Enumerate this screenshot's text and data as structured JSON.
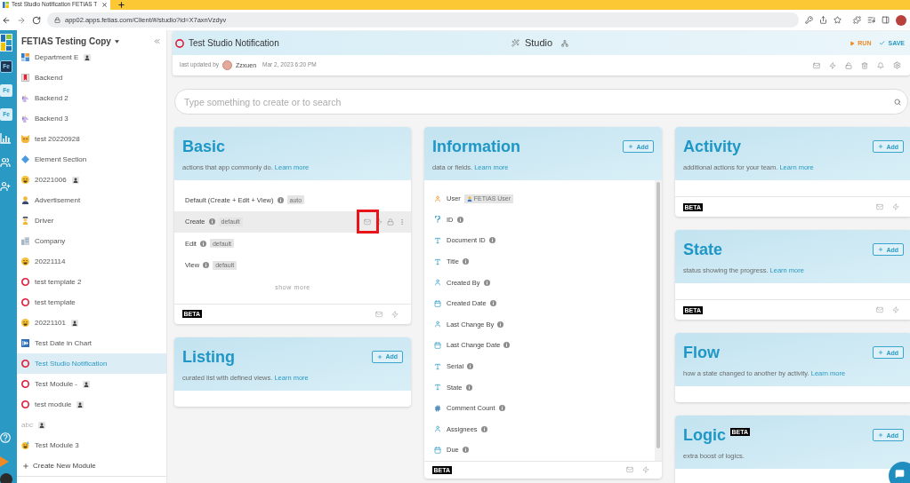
{
  "browser": {
    "tab_title": "Test Studio Notification FETIAS T",
    "url": "app02.apps.fetias.com/Client/#/studio?id=X7axnVzdyv"
  },
  "rail": {
    "tiles": [
      {
        "label": "Fe",
        "selected": true
      },
      {
        "label": "Fe",
        "selected": false
      },
      {
        "label": "Fe",
        "selected": false
      }
    ]
  },
  "sidebar": {
    "workspace": "FETIAS Testing Copy",
    "items": [
      {
        "label": "Department E",
        "badge": true,
        "selected": false,
        "disabled": false
      },
      {
        "label": "Backend",
        "badge": false,
        "selected": false,
        "disabled": false
      },
      {
        "label": "Backend 2",
        "badge": false,
        "selected": false,
        "disabled": false
      },
      {
        "label": "Backend 3",
        "badge": false,
        "selected": false,
        "disabled": false
      },
      {
        "label": "test 20220928",
        "badge": false,
        "selected": false,
        "disabled": false
      },
      {
        "label": "Element Section",
        "badge": false,
        "selected": false,
        "disabled": false
      },
      {
        "label": "20221006",
        "badge": true,
        "selected": false,
        "disabled": false
      },
      {
        "label": "Advertisement",
        "badge": false,
        "selected": false,
        "disabled": false
      },
      {
        "label": "Driver",
        "badge": false,
        "selected": false,
        "disabled": false
      },
      {
        "label": "Company",
        "badge": false,
        "selected": false,
        "disabled": false
      },
      {
        "label": "20221114",
        "badge": false,
        "selected": false,
        "disabled": false
      },
      {
        "label": "test template 2",
        "badge": false,
        "selected": false,
        "disabled": false
      },
      {
        "label": "test template",
        "badge": false,
        "selected": false,
        "disabled": false
      },
      {
        "label": "20221101",
        "badge": true,
        "selected": false,
        "disabled": false
      },
      {
        "label": "Test Date in Chart",
        "badge": false,
        "selected": false,
        "disabled": false
      },
      {
        "label": "Test Studio Notification",
        "badge": false,
        "selected": true,
        "disabled": false
      },
      {
        "label": "Test Module -",
        "badge": true,
        "selected": false,
        "disabled": false
      },
      {
        "label": "test module",
        "badge": true,
        "selected": false,
        "disabled": false
      },
      {
        "label": "abc",
        "badge": true,
        "selected": false,
        "disabled": true
      },
      {
        "label": "Test Module 3",
        "badge": false,
        "selected": false,
        "disabled": false
      }
    ],
    "create_label": "Create New Module"
  },
  "header": {
    "title": "Test Studio Notification",
    "mode": "Studio",
    "run_label": "RUN",
    "save_label": "SAVE",
    "updated_label": "last updated by",
    "updated_user": "Zzxuen",
    "updated_date": "Mar 2, 2023 6:20 PM"
  },
  "search": {
    "placeholder": "Type something to create or to search"
  },
  "board": {
    "columns": [
      {
        "cards": [
          {
            "kind": "actions",
            "title": "Basic",
            "description": "actions that app commonly do.",
            "link": "Learn more",
            "rows": [
              {
                "label": "Default (Create + Edit + View)",
                "info": true,
                "tag": "auto",
                "selected": false,
                "annotated": false
              },
              {
                "label": "Create",
                "info": true,
                "tag": "default",
                "selected": true,
                "annotated": true
              },
              {
                "label": "Edit",
                "info": true,
                "tag": "default",
                "selected": false,
                "annotated": false
              },
              {
                "label": "View",
                "info": true,
                "tag": "default",
                "selected": false,
                "annotated": false
              }
            ],
            "show_more": "show more",
            "footer_badge": "BETA"
          },
          {
            "kind": "empty",
            "title": "Listing",
            "add_label": "Add",
            "description": "curated list with defined views.",
            "link": "Learn more"
          }
        ]
      },
      {
        "cards": [
          {
            "kind": "fields",
            "title": "Information",
            "add_label": "Add",
            "description": "data or fields.",
            "link": "Learn more",
            "rows": [
              {
                "kind": "user",
                "label": "User",
                "info": false,
                "tag": "FETIAS User"
              },
              {
                "kind": "id",
                "label": "ID",
                "info": true
              },
              {
                "kind": "text",
                "label": "Document ID",
                "info": true
              },
              {
                "kind": "text",
                "label": "Title",
                "info": true
              },
              {
                "kind": "person",
                "label": "Created By",
                "info": true
              },
              {
                "kind": "date",
                "label": "Created Date",
                "info": true
              },
              {
                "kind": "person",
                "label": "Last Change By",
                "info": true
              },
              {
                "kind": "date",
                "label": "Last Change Date",
                "info": true
              },
              {
                "kind": "text",
                "label": "Serial",
                "info": true
              },
              {
                "kind": "text",
                "label": "State",
                "info": true
              },
              {
                "kind": "number",
                "label": "Comment Count",
                "info": true
              },
              {
                "kind": "person",
                "label": "Assignees",
                "info": true
              },
              {
                "kind": "date",
                "label": "Due",
                "info": true
              }
            ],
            "footer_badge": "BETA"
          }
        ]
      },
      {
        "cards": [
          {
            "kind": "empty",
            "title": "Activity",
            "add_label": "Add",
            "description": "additional actions for your team.",
            "link": "Learn more",
            "footer_badge": "BETA"
          },
          {
            "kind": "empty",
            "title": "State",
            "add_label": "Add",
            "description": "status showing the progress.",
            "link": "Learn more",
            "footer_badge": "BETA"
          },
          {
            "kind": "empty",
            "title": "Flow",
            "add_label": "Add",
            "description": "how a state changed to another by activity.",
            "link": "Learn more"
          },
          {
            "kind": "empty",
            "title": "Logic",
            "title_badge": "BETA",
            "add_label": "Add",
            "description": "extra boost of logics."
          }
        ]
      }
    ]
  }
}
